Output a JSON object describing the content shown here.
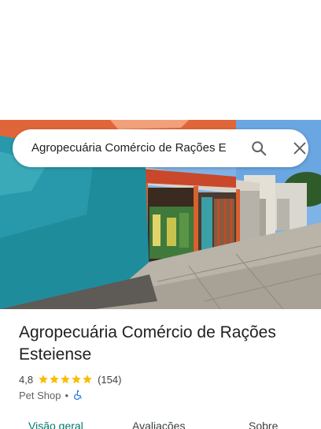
{
  "search": {
    "query": "Agropecuária Comércio de Rações E"
  },
  "place": {
    "name": "Agropecuária Comércio de Rações Esteiense",
    "rating": "4,8",
    "stars_filled": 5,
    "review_count": "(154)",
    "category": "Pet Shop",
    "separator": "•"
  },
  "tabs": [
    {
      "label": "Visão geral",
      "active": true
    },
    {
      "label": "Avaliações",
      "active": false
    },
    {
      "label": "Sobre",
      "active": false
    }
  ],
  "colors": {
    "accent": "#00796b",
    "star": "#fbbc04",
    "wheelchair": "#1a73e8"
  },
  "icons": {
    "search": "search-icon",
    "close": "close-icon",
    "accessibility": "wheelchair-icon",
    "star": "star-icon"
  }
}
